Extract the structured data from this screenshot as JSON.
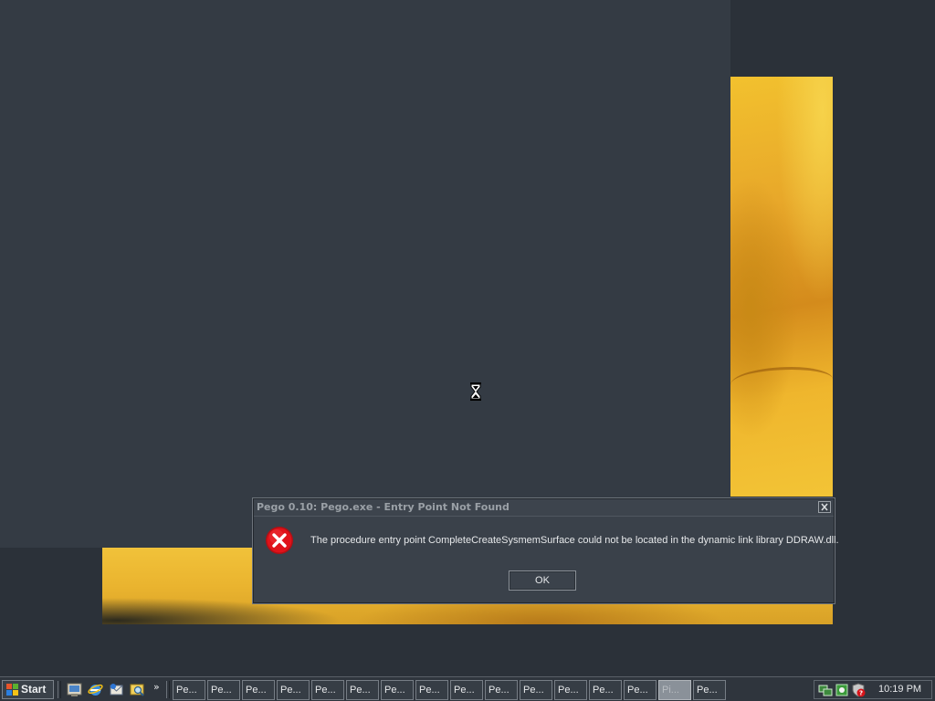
{
  "dialog": {
    "title": "Pego 0.10: Pego.exe - Entry Point Not Found",
    "message": "The procedure entry point CompleteCreateSysmemSurface could not be located in the dynamic link library DDRAW.dll.",
    "ok_label": "OK",
    "icon": "error-icon"
  },
  "taskbar": {
    "start_label": "Start",
    "quick_launch": [
      "show-desktop-icon",
      "internet-explorer-icon",
      "outlook-express-icon",
      "explorer-icon"
    ],
    "overflow_label": "»",
    "tasks": [
      {
        "label": "Pe..."
      },
      {
        "label": "Pe..."
      },
      {
        "label": "Pe..."
      },
      {
        "label": "Pe..."
      },
      {
        "label": "Pe..."
      },
      {
        "label": "Pe..."
      },
      {
        "label": "Pe..."
      },
      {
        "label": "Pe..."
      },
      {
        "label": "Pe..."
      },
      {
        "label": "Pe..."
      },
      {
        "label": "Pe..."
      },
      {
        "label": "Pe..."
      },
      {
        "label": "Pe..."
      },
      {
        "label": "Pe..."
      },
      {
        "label": "Pi...",
        "active": true
      },
      {
        "label": "Pe..."
      }
    ],
    "tray_icons": [
      "network-icon",
      "media-icon",
      "security-alert-icon"
    ],
    "clock": "10:19 PM"
  },
  "colors": {
    "desktop": "#2b3139",
    "panel": "#343b44",
    "dialog_bg": "#3a414a",
    "error_red": "#e0121a",
    "wallpaper_yellow": "#f1c23a"
  },
  "cursor": "hourglass-icon"
}
